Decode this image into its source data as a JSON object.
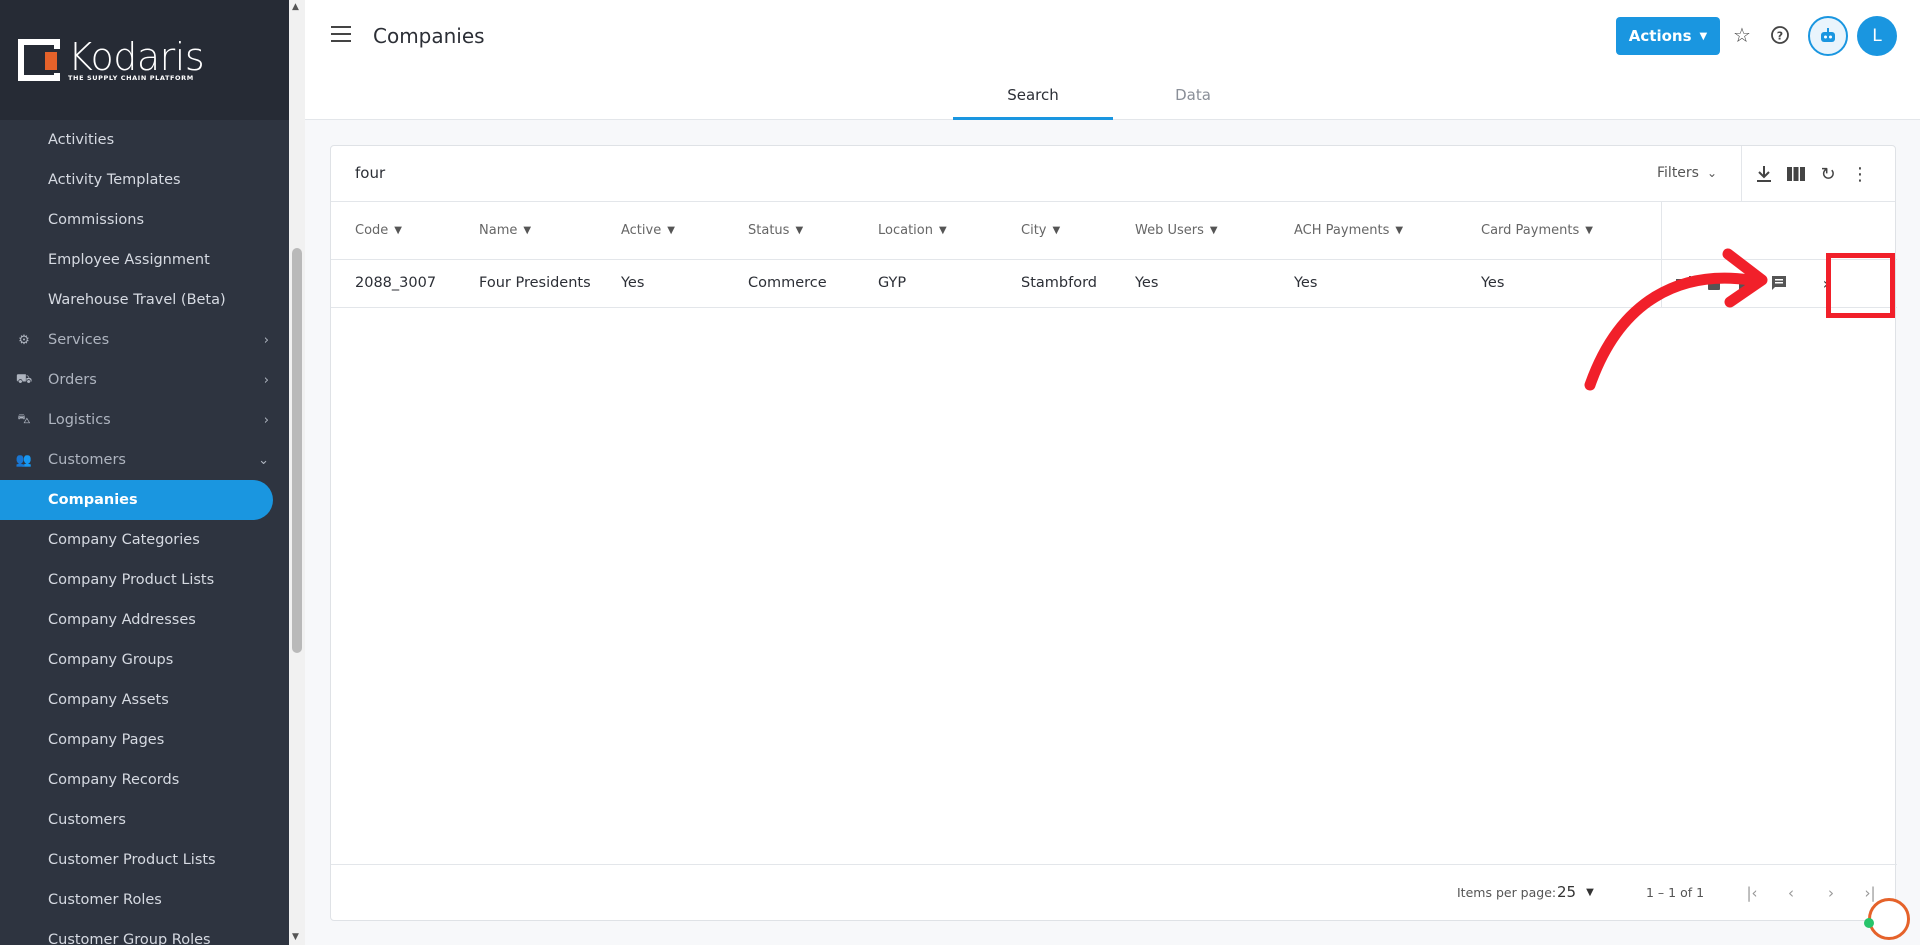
{
  "app": {
    "logo_text": "Kodaris",
    "logo_sub": "THE SUPPLY CHAIN PLATFORM"
  },
  "sidebar": {
    "items": [
      {
        "label": "Activities",
        "type": "child"
      },
      {
        "label": "Activity Templates",
        "type": "child"
      },
      {
        "label": "Commissions",
        "type": "child"
      },
      {
        "label": "Employee Assignment",
        "type": "child"
      },
      {
        "label": "Warehouse Travel (Beta)",
        "type": "child"
      },
      {
        "label": "Services",
        "type": "section",
        "icon": "services-icon"
      },
      {
        "label": "Orders",
        "type": "section",
        "icon": "truck-icon"
      },
      {
        "label": "Logistics",
        "type": "section",
        "icon": "shipping-icon"
      },
      {
        "label": "Customers",
        "type": "section-open",
        "icon": "people-icon"
      },
      {
        "label": "Companies",
        "type": "active"
      },
      {
        "label": "Company Categories",
        "type": "child"
      },
      {
        "label": "Company Product Lists",
        "type": "child"
      },
      {
        "label": "Company Addresses",
        "type": "child"
      },
      {
        "label": "Company Groups",
        "type": "child"
      },
      {
        "label": "Company Assets",
        "type": "child"
      },
      {
        "label": "Company Pages",
        "type": "child"
      },
      {
        "label": "Company Records",
        "type": "child"
      },
      {
        "label": "Customers",
        "type": "child"
      },
      {
        "label": "Customer Product Lists",
        "type": "child"
      },
      {
        "label": "Customer Roles",
        "type": "child"
      },
      {
        "label": "Customer Group Roles",
        "type": "child"
      }
    ]
  },
  "header": {
    "title": "Companies",
    "actions_label": "Actions",
    "avatar_initial": "L",
    "tabs": [
      {
        "label": "Search",
        "active": true
      },
      {
        "label": "Data",
        "active": false
      }
    ]
  },
  "search": {
    "value": "four",
    "filters_label": "Filters"
  },
  "table": {
    "columns": [
      "Code",
      "Name",
      "Active",
      "Status",
      "Location",
      "City",
      "Web Users",
      "ACH Payments",
      "Card Payments"
    ],
    "rows": [
      [
        "2088_3007",
        "Four Presidents",
        "Yes",
        "Commerce",
        "GYP",
        "Stambford",
        "Yes",
        "Yes",
        "Yes"
      ]
    ]
  },
  "footer": {
    "items_per_page_label": "Items per page:",
    "items_per_page": "25",
    "range": "1 – 1 of 1"
  },
  "colors": {
    "accent": "#1a96e0",
    "sidebar_bg": "#2e3440",
    "highlight": "#f1202a",
    "brand_orange": "#e5622a"
  }
}
